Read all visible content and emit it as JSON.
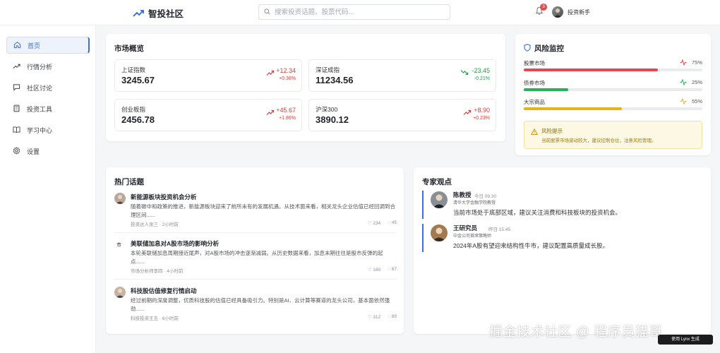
{
  "app": {
    "title": "智投社区"
  },
  "search": {
    "placeholder": "搜索投资话题、股票代码..."
  },
  "notifications": {
    "count": "3"
  },
  "user": {
    "name": "投资新手"
  },
  "sidebar": {
    "items": [
      {
        "label": "首页",
        "icon": "home-icon",
        "active": true
      },
      {
        "label": "行情分析",
        "icon": "trend-icon"
      },
      {
        "label": "社区讨论",
        "icon": "chat-icon"
      },
      {
        "label": "投资工具",
        "icon": "calculator-icon"
      },
      {
        "label": "学习中心",
        "icon": "book-icon"
      },
      {
        "label": "设置",
        "icon": "gear-icon"
      }
    ]
  },
  "market": {
    "title": "市场概览",
    "indices": [
      {
        "name": "上证指数",
        "value": "3245.67",
        "change": "+12.34",
        "pct": "+0.38%",
        "direction": "up"
      },
      {
        "name": "深证成指",
        "value": "11234.56",
        "change": "-23.45",
        "pct": "-0.21%",
        "direction": "down"
      },
      {
        "name": "创业板指",
        "value": "2456.78",
        "change": "+45.67",
        "pct": "+1.86%",
        "direction": "up"
      },
      {
        "name": "沪深300",
        "value": "3890.12",
        "change": "+8.90",
        "pct": "+0.23%",
        "direction": "up"
      }
    ]
  },
  "risk": {
    "title": "风险监控",
    "items": [
      {
        "label": "股票市场",
        "pct": "75%",
        "level": 0.75,
        "color": "#e5484d"
      },
      {
        "label": "债券市场",
        "pct": "25%",
        "level": 0.25,
        "color": "#22b455"
      },
      {
        "label": "大宗商品",
        "pct": "55%",
        "level": 0.55,
        "color": "#e8b21b"
      }
    ],
    "alert": {
      "title": "风险提示",
      "text": "当前股票市场波动较大，建议控制仓位，注意风险管理。"
    }
  },
  "topics": {
    "title": "热门话题",
    "items": [
      {
        "title": "新能源板块投资机会分析",
        "desc": "随着碳中和政策的推进，新能源板块迎来了前所未有的发展机遇。从技术面来看，相关龙头企业估值已经回调到合理区间......",
        "meta": "投资达人张三 · 2小时前",
        "likes": "234",
        "comments": "45"
      },
      {
        "title": "美联储加息对A股市场的影响分析",
        "desc": "本轮美联储加息周期接近尾声，对A股市场的冲击逐渐减弱。从历史数据来看，加息末期往往是股市反弹的起点......",
        "meta": "市场分析师李四 · 4小时前",
        "likes": "189",
        "comments": "67",
        "avatar_alt": "市"
      },
      {
        "title": "科技股估值修复行情启动",
        "desc": "经过前期的深度调整，优质科技股的估值已经具备吸引力。特别是AI、云计算等赛道的龙头公司，基本面依然强劲......",
        "meta": "科技投资王五 · 6小时前",
        "likes": "312",
        "comments": "89"
      }
    ]
  },
  "experts": {
    "title": "专家观点",
    "items": [
      {
        "name": "陈教授",
        "time": "今日 09:30",
        "org": "清华大学金融学院教授",
        "quote": "当前市场处于底部区域，建议关注消费和科技板块的投资机会。"
      },
      {
        "name": "王研究员",
        "time": "昨日 15:45",
        "org": "中金公司首席策略师",
        "quote": "2024年A股有望迎来结构性牛市，建议配置高质量成长股。"
      }
    ]
  },
  "watermark": {
    "text": "掘金技术社区 @ 程序员猫哥",
    "badge": "使用 Lynx 生成"
  },
  "colors": {
    "accent": "#3b6fd6",
    "up": "#e03a3a",
    "down": "#1fa04a"
  }
}
